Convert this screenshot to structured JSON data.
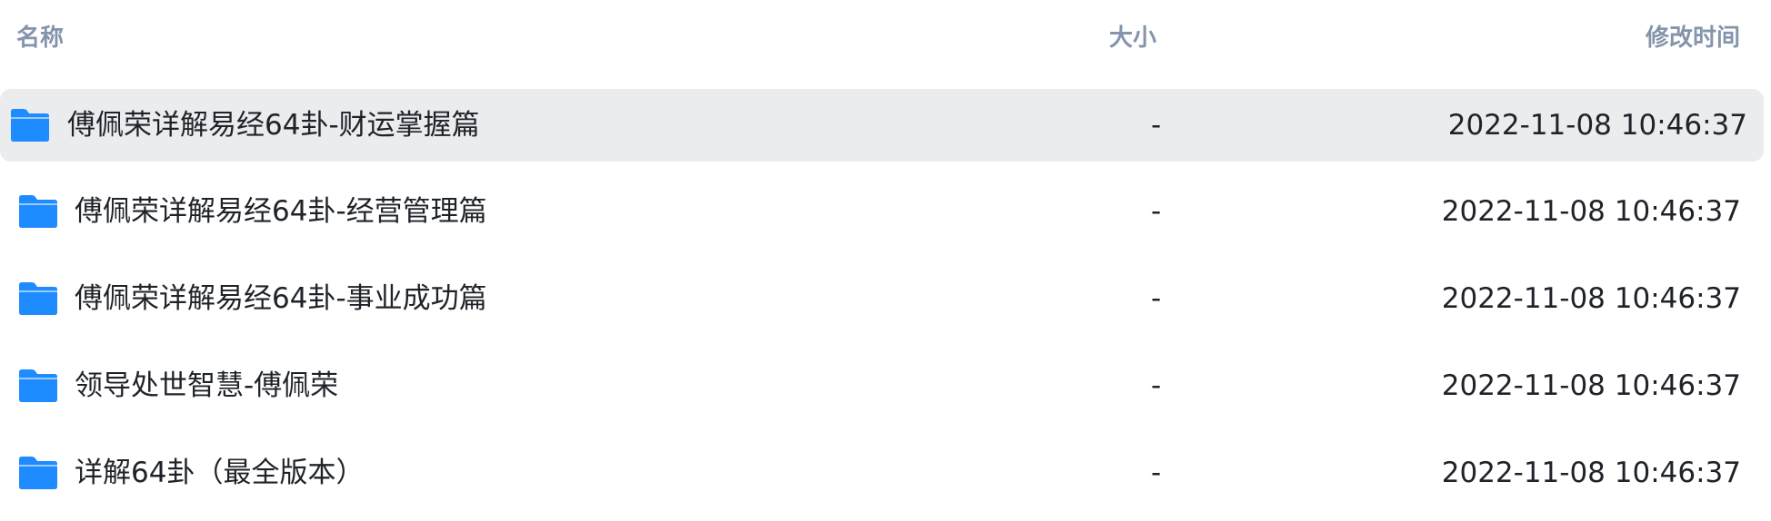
{
  "columns": {
    "name": "名称",
    "size": "大小",
    "modified": "修改时间"
  },
  "rows": [
    {
      "name": "傅佩荣详解易经64卦-财运掌握篇",
      "size": "-",
      "modified": "2022-11-08 10:46:37",
      "selected": true,
      "icon": "folder-icon"
    },
    {
      "name": "傅佩荣详解易经64卦-经营管理篇",
      "size": "-",
      "modified": "2022-11-08 10:46:37",
      "selected": false,
      "icon": "folder-icon"
    },
    {
      "name": "傅佩荣详解易经64卦-事业成功篇",
      "size": "-",
      "modified": "2022-11-08 10:46:37",
      "selected": false,
      "icon": "folder-icon"
    },
    {
      "name": "领导处世智慧-傅佩荣",
      "size": "-",
      "modified": "2022-11-08 10:46:37",
      "selected": false,
      "icon": "folder-icon"
    },
    {
      "name": "详解64卦（最全版本）",
      "size": "-",
      "modified": "2022-11-08 10:46:37",
      "selected": false,
      "icon": "folder-icon"
    }
  ],
  "colors": {
    "folder": "#1e8cff",
    "header_text": "#8494ab",
    "row_text": "#1f2329",
    "selected_row": "#ebecee"
  }
}
